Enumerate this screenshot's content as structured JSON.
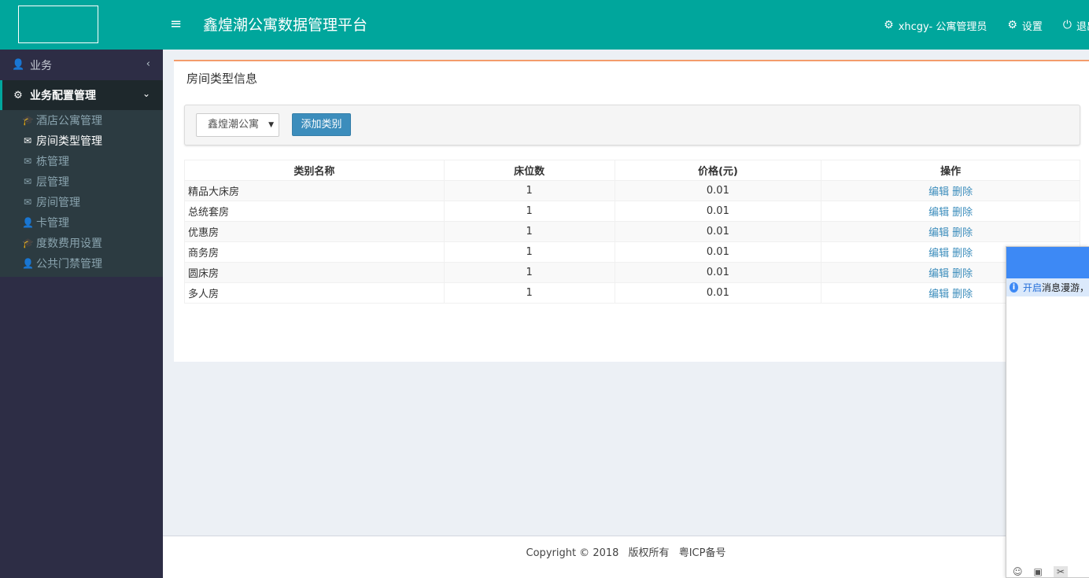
{
  "header": {
    "title": "鑫煌潮公寓数据管理平台",
    "menu_icon": "hamburger-icon",
    "user_label": "xhcgy- 公寓管理员",
    "settings_label": "设置",
    "logout_label": "退出",
    "brand_color": "#00a69c"
  },
  "sidebar": {
    "section_business": "业务",
    "section_config": "业务配置管理",
    "items": [
      {
        "label": "酒店公寓管理",
        "icon": "graduation-cap-icon"
      },
      {
        "label": "房间类型管理",
        "icon": "envelope-icon"
      },
      {
        "label": "栋管理",
        "icon": "envelope-icon"
      },
      {
        "label": "层管理",
        "icon": "envelope-icon"
      },
      {
        "label": "房间管理",
        "icon": "envelope-icon"
      },
      {
        "label": "卡管理",
        "icon": "user-icon"
      },
      {
        "label": "度数费用设置",
        "icon": "graduation-cap-icon"
      },
      {
        "label": "公共门禁管理",
        "icon": "user-icon"
      }
    ]
  },
  "main": {
    "box_title": "房间类型信息",
    "select_value": "鑫煌潮公寓",
    "add_button": "添加类别",
    "table": {
      "headers": [
        "类别名称",
        "床位数",
        "价格(元)",
        "操作"
      ],
      "edit_label": "编辑",
      "delete_label": "删除",
      "rows": [
        {
          "name": "精品大床房",
          "beds": "1",
          "price": "0.01"
        },
        {
          "name": "总统套房",
          "beds": "1",
          "price": "0.01"
        },
        {
          "name": "优惠房",
          "beds": "1",
          "price": "0.01"
        },
        {
          "name": "商务房",
          "beds": "1",
          "price": "0.01"
        },
        {
          "name": "圆床房",
          "beds": "1",
          "price": "0.01"
        },
        {
          "name": "多人房",
          "beds": "1",
          "price": "0.01"
        }
      ]
    }
  },
  "footer": {
    "copyright": "Copyright © 2018",
    "rights": "版权所有",
    "icp": "粤ICP备号"
  },
  "chat": {
    "notice_open": "开启",
    "notice_rest": "消息漫游，"
  }
}
